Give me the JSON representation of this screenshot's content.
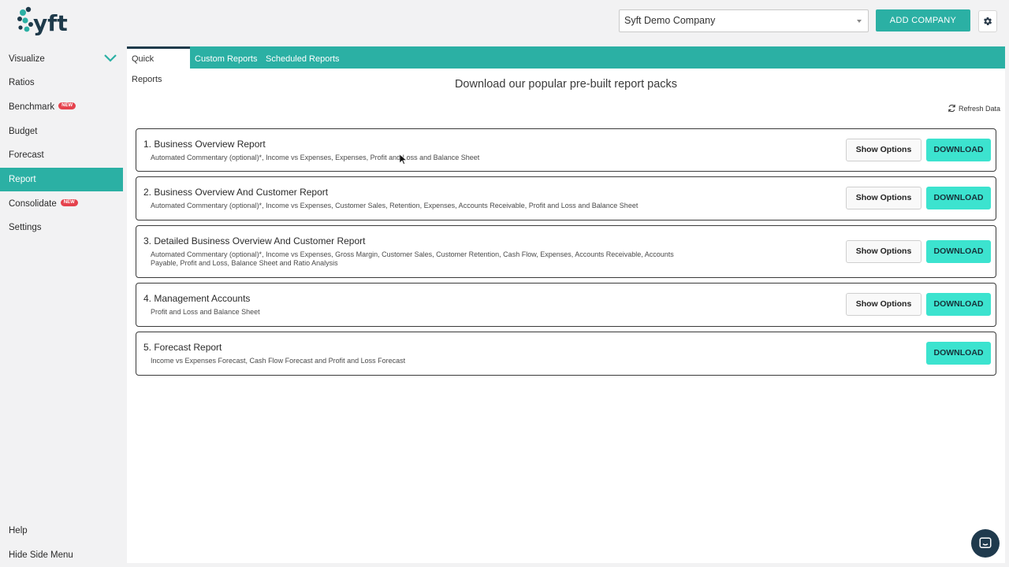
{
  "header": {
    "logo_text": "syft",
    "company_select": "Syft Demo Company",
    "add_company_label": "ADD COMPANY",
    "settings_icon": "gear-icon"
  },
  "sidebar": {
    "items": [
      {
        "label": "Visualize",
        "badge": "",
        "active": false
      },
      {
        "label": "Ratios",
        "badge": "",
        "active": false
      },
      {
        "label": "Benchmark",
        "badge": "NEW",
        "active": false
      },
      {
        "label": "Budget",
        "badge": "",
        "active": false
      },
      {
        "label": "Forecast",
        "badge": "",
        "active": false
      },
      {
        "label": "Report",
        "badge": "",
        "active": true
      },
      {
        "label": "Consolidate",
        "badge": "NEW",
        "active": false
      },
      {
        "label": "Settings",
        "badge": "",
        "active": false
      }
    ],
    "footer": {
      "help": "Help",
      "hide_menu": "Hide Side Menu"
    }
  },
  "tabs": [
    {
      "label": "Quick Reports",
      "active": true
    },
    {
      "label": "Custom Reports",
      "active": false
    },
    {
      "label": "Scheduled Reports",
      "active": false
    }
  ],
  "main": {
    "heading": "Download our popular pre-built report packs",
    "refresh_label": "Refresh Data",
    "show_options_label": "Show Options",
    "download_label": "DOWNLOAD",
    "reports": [
      {
        "title": "1. Business Overview Report",
        "description": "Automated Commentary (optional)*, Income vs Expenses, Expenses, Profit and Loss and Balance Sheet",
        "has_options": true
      },
      {
        "title": "2. Business Overview And Customer Report",
        "description": "Automated Commentary (optional)*, Income vs Expenses, Customer Sales, Retention, Expenses, Accounts Receivable, Profit and Loss and Balance Sheet",
        "has_options": true
      },
      {
        "title": "3. Detailed Business Overview And Customer Report",
        "description": "Automated Commentary (optional)*, Income vs Expenses, Gross Margin, Customer Sales, Customer Retention, Cash Flow, Expenses, Accounts Receivable, Accounts Payable, Profit and Loss, Balance Sheet and Ratio Analysis",
        "has_options": true
      },
      {
        "title": "4. Management Accounts",
        "description": "Profit and Loss and Balance Sheet",
        "has_options": true
      },
      {
        "title": "5. Forecast Report",
        "description": "Income vs Expenses Forecast, Cash Flow Forecast and Profit and Loss Forecast",
        "has_options": false
      }
    ]
  },
  "colors": {
    "accent": "#2bb0a4",
    "download": "#3ce3cf",
    "badge_new": "#e5424d",
    "chat": "#1f3a4d"
  }
}
